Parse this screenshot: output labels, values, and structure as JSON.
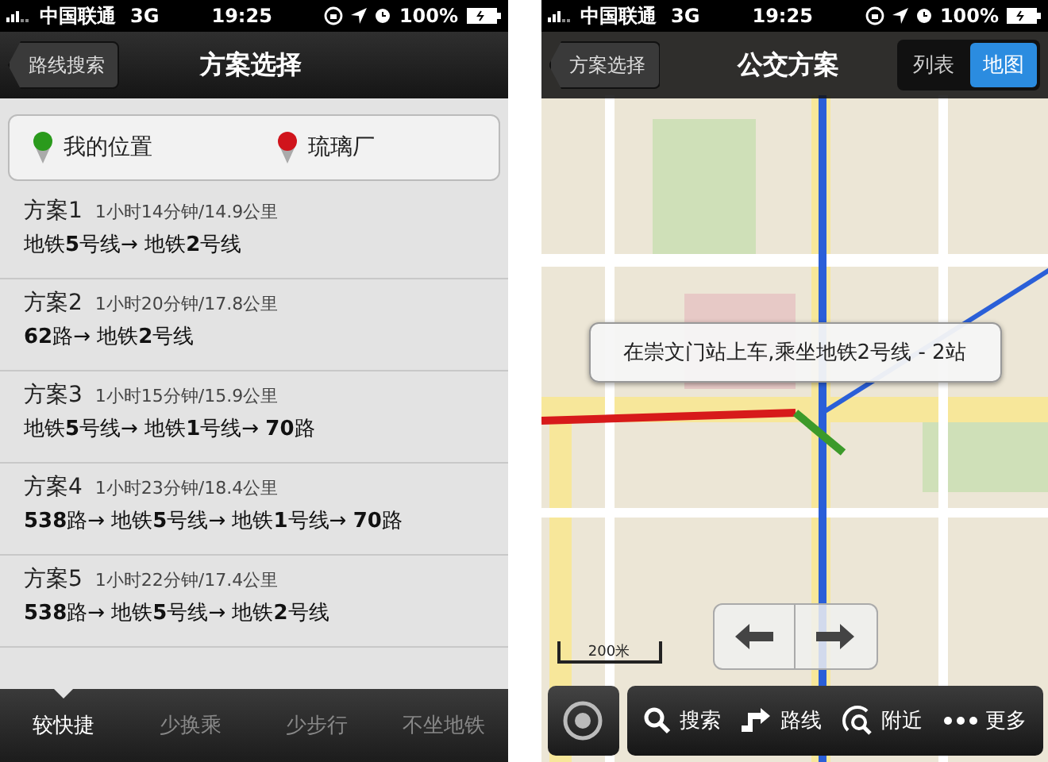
{
  "screens": [
    {
      "status_bar": {
        "carrier": "中国联通",
        "network": "3G",
        "time": "19:25",
        "battery": "100%"
      },
      "nav_bar": {
        "back": "路线搜索",
        "title": "方案选择"
      },
      "endpoints": [
        {
          "label": "我的位置",
          "color": "#2a9a1c"
        },
        {
          "label": "琉璃厂",
          "color": "#d0141c"
        }
      ],
      "plans": [
        {
          "name": "方案1",
          "summary": "1小时14分钟/14.9公里",
          "route": "地铁**5**号线→ 地铁**2**号线"
        },
        {
          "name": "方案2",
          "summary": "1小时20分钟/17.8公里",
          "route": "**62**路→ 地铁**2**号线"
        },
        {
          "name": "方案3",
          "summary": "1小时15分钟/15.9公里",
          "route": "地铁**5**号线→ 地铁**1**号线→ **70**路"
        },
        {
          "name": "方案4",
          "summary": "1小时23分钟/18.4公里",
          "route": "**538**路→ 地铁**5**号线→ 地铁**1**号线→ **70**路"
        },
        {
          "name": "方案5",
          "summary": "1小时22分钟/17.4公里",
          "route": "**538**路→ 地铁**5**号线→ 地铁**2**号线"
        }
      ],
      "tabs": [
        {
          "label": "较快捷",
          "selected": true
        },
        {
          "label": "少换乘",
          "selected": false
        },
        {
          "label": "少步行",
          "selected": false
        },
        {
          "label": "不坐地铁",
          "selected": false
        }
      ]
    },
    {
      "status_bar": {
        "carrier": "中国联通",
        "network": "3G",
        "time": "19:25",
        "battery": "100%"
      },
      "nav_bar": {
        "back": "方案选择",
        "title": "公交方案",
        "segments": [
          {
            "label": "列表",
            "selected": false
          },
          {
            "label": "地图",
            "selected": true
          }
        ]
      },
      "map": {
        "callout": "在崇文门站上车,乘坐地铁2号线 - 2站",
        "scale": "200米"
      },
      "toolbar": [
        {
          "label": "搜索",
          "kind": "search"
        },
        {
          "label": "路线",
          "kind": "route"
        },
        {
          "label": "附近",
          "kind": "nearby"
        },
        {
          "label": "更多",
          "kind": "more"
        }
      ]
    }
  ]
}
